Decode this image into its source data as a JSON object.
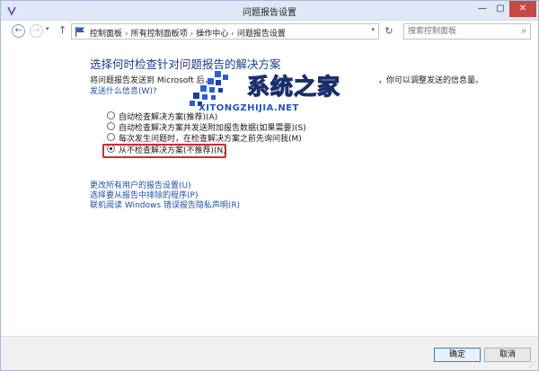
{
  "window": {
    "title": "问题报告设置",
    "controls": {
      "minimize": "—",
      "maximize": "▢",
      "close": "✕"
    }
  },
  "nav": {
    "back": "←",
    "forward": "→",
    "dropdown": "▾",
    "up": "↑",
    "breadcrumbs": [
      "控制面板",
      "所有控制面板项",
      "操作中心",
      "问题报告设置"
    ],
    "separator": "›",
    "address_dropdown": "▾",
    "refresh": "↻",
    "search_placeholder": "搜索控制面板"
  },
  "main": {
    "heading": "选择何时检查针对问题报告的解决方案",
    "description": "将问题报告发送到 Microsoft 后，",
    "description_tail": "，你可以调整发送的信息量。",
    "privacy_link": "发送什么信息(W)?",
    "options": [
      {
        "label": "自动检查解决方案(推荐)(A)",
        "selected": false
      },
      {
        "label": "自动检查解决方案并发送附加报告数据(如果需要)(S)",
        "selected": false
      },
      {
        "label": "每次发生问题时，在检查解决方案之前先询问我(M)",
        "selected": false
      },
      {
        "label": "从不检查解决方案(不推荐)(N)",
        "selected": true
      }
    ],
    "links": [
      "更改所有用户的报告设置(U)",
      "选择要从报告中排除的程序(P)",
      "联机阅读 Windows 错误报告隐私声明(R)"
    ]
  },
  "watermark": {
    "title": "系统之家",
    "subtitle": "XITONGZHIJIA.NET"
  },
  "footer": {
    "ok_label": "确定",
    "cancel_label": "取消"
  },
  "colors": {
    "heading": "#1e3f8a",
    "link": "#1f4fa7",
    "highlight_border": "#d42a2a",
    "close_button": "#c7493f"
  }
}
